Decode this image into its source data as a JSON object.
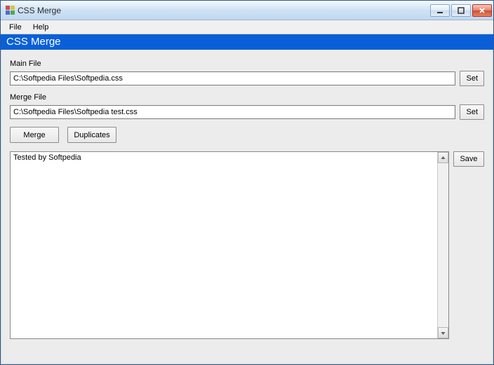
{
  "window": {
    "title": "CSS Merge"
  },
  "menubar": {
    "file": "File",
    "help": "Help"
  },
  "header": {
    "title": "CSS Merge"
  },
  "mainFile": {
    "label": "Main File",
    "value": "C:\\Softpedia Files\\Softpedia.css",
    "setLabel": "Set"
  },
  "mergeFile": {
    "label": "Merge File",
    "value": "C:\\Softpedia Files\\Softpedia test.css",
    "setLabel": "Set"
  },
  "actions": {
    "merge": "Merge",
    "duplicates": "Duplicates"
  },
  "output": {
    "text": "Tested by Softpedia",
    "saveLabel": "Save"
  }
}
